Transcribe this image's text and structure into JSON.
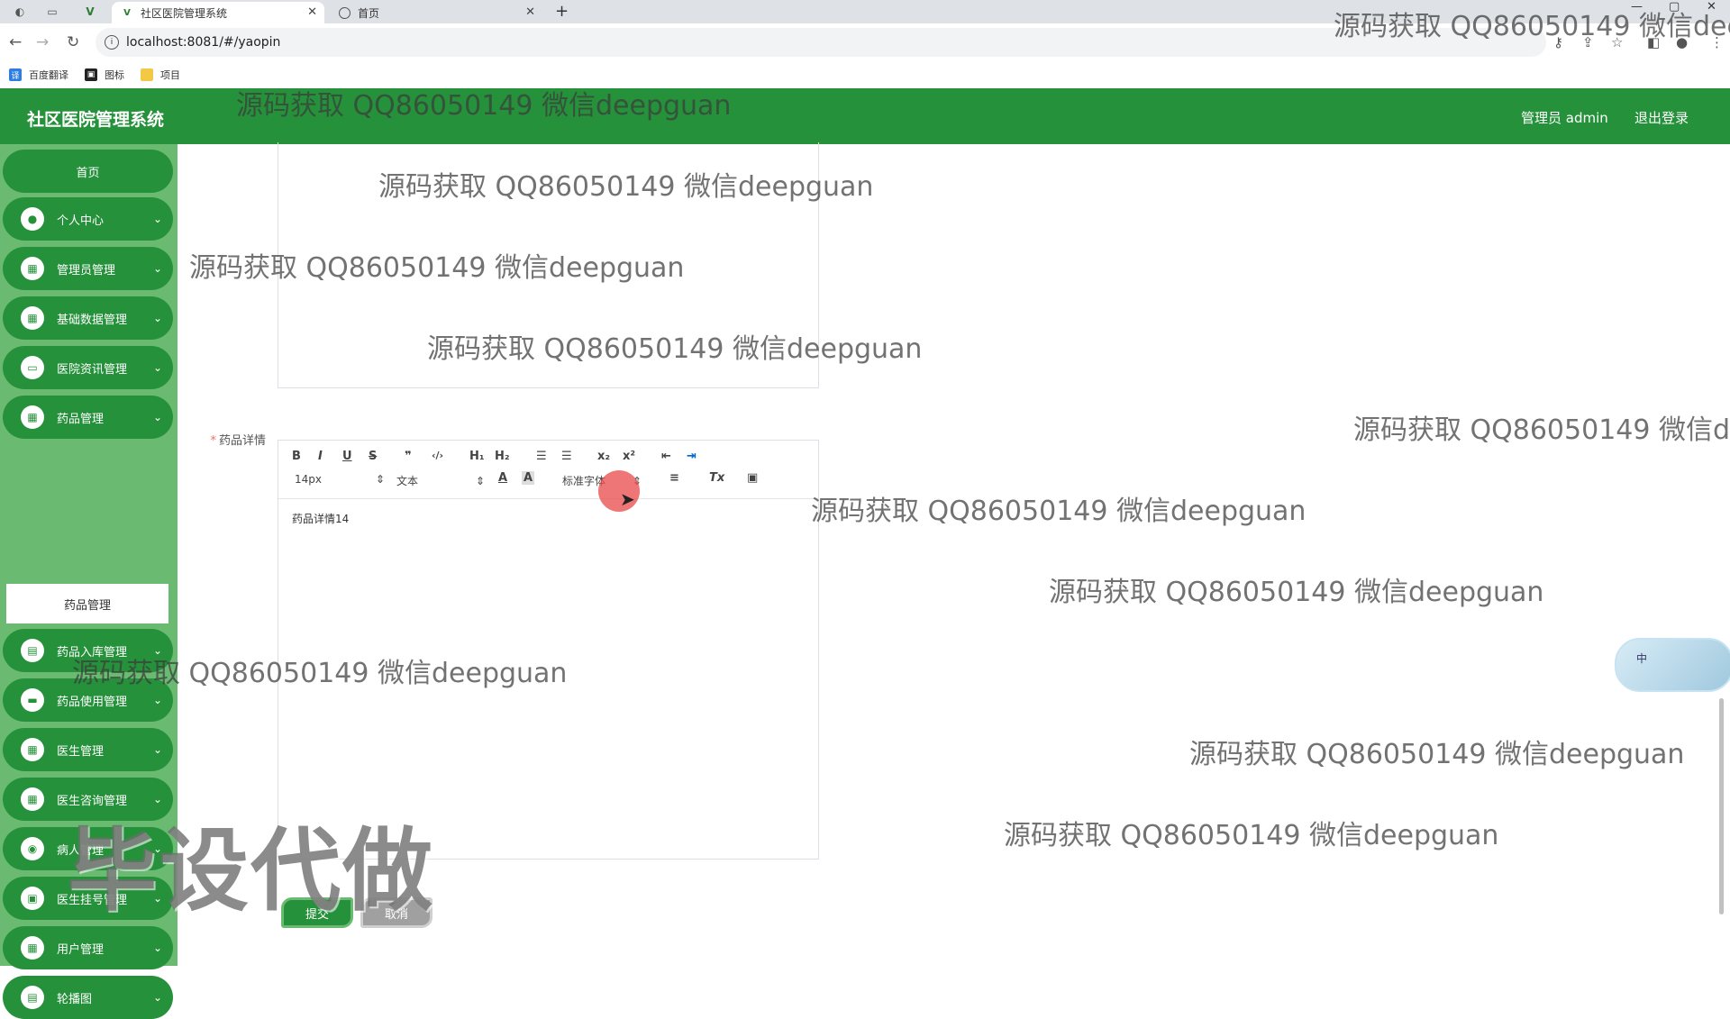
{
  "browser": {
    "tabs": [
      {
        "title": "社区医院管理系统",
        "active": true
      },
      {
        "title": "首页",
        "active": false
      }
    ],
    "url": "localhost:8081/#/yaopin",
    "bookmarks": [
      "百度翻译",
      "图标",
      "项目"
    ]
  },
  "header": {
    "title": "社区医院管理系统",
    "user": "管理员 admin",
    "logout": "退出登录"
  },
  "sidebar": {
    "home": "首页",
    "items": [
      {
        "label": "个人中心",
        "icon": "person-icon"
      },
      {
        "label": "管理员管理",
        "icon": "grid-icon"
      },
      {
        "label": "基础数据管理",
        "icon": "grid-icon"
      },
      {
        "label": "医院资讯管理",
        "icon": "monitor-icon"
      },
      {
        "label": "药品管理",
        "icon": "grid-icon"
      },
      {
        "label": "药品入库管理",
        "icon": "clipboard-icon"
      },
      {
        "label": "药品使用管理",
        "icon": "chat-icon"
      },
      {
        "label": "医生管理",
        "icon": "grid-icon"
      },
      {
        "label": "医生咨询管理",
        "icon": "grid-icon"
      },
      {
        "label": "病人管理",
        "icon": "location-icon"
      },
      {
        "label": "医生挂号管理",
        "icon": "ticket-icon"
      },
      {
        "label": "用户管理",
        "icon": "grid-icon"
      },
      {
        "label": "轮播图",
        "icon": "doc-icon"
      }
    ],
    "active_sub": "药品管理"
  },
  "form": {
    "detail_label": "药品详情",
    "font_size": "14px",
    "text_type": "文本",
    "font_family": "标准字体",
    "content": "药品详情14",
    "submit": "提交",
    "cancel": "取消"
  },
  "overlay": {
    "watermark": "源码获取 QQ86050149 微信deepguan",
    "big_watermark": "毕设代做",
    "ime": "中"
  }
}
